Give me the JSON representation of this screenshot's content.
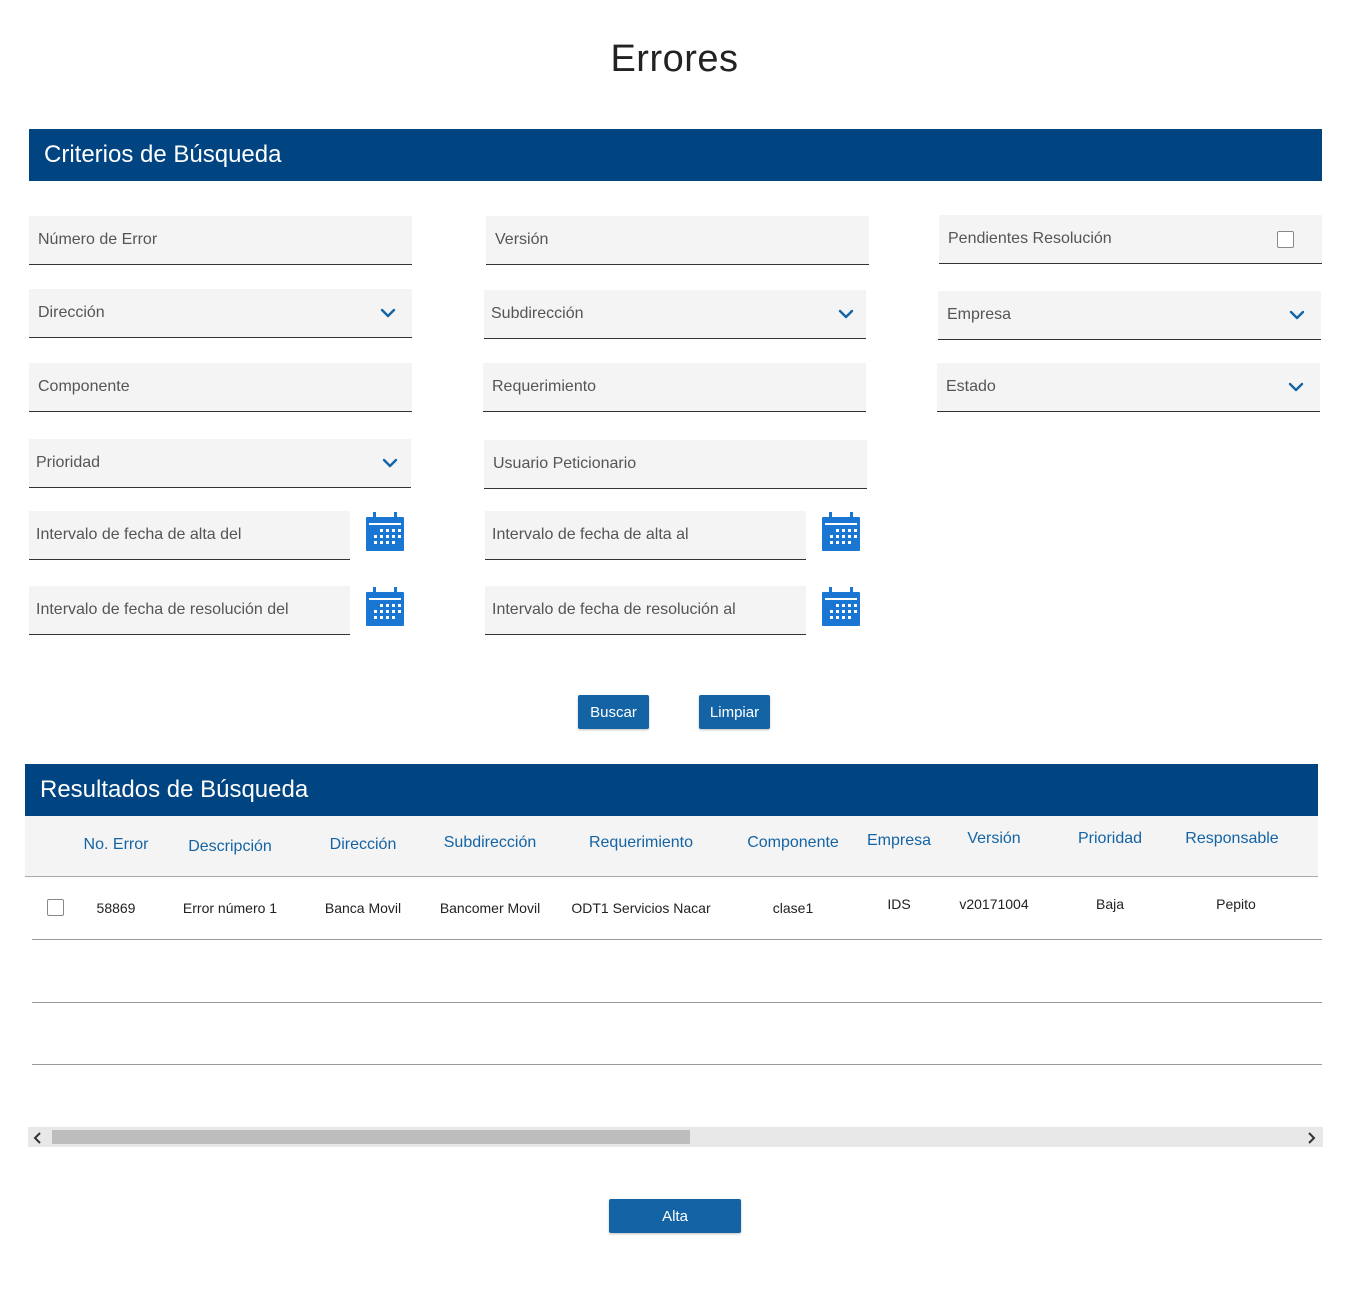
{
  "page": {
    "title": "Errores"
  },
  "search": {
    "section_title": "Criterios de Búsqueda",
    "fields": {
      "numero_error": "Número de Error",
      "version": "Versión",
      "pendientes": "Pendientes Resolución",
      "direccion": "Dirección",
      "subdireccion": "Subdirección",
      "empresa": "Empresa",
      "componente": "Componente",
      "requerimiento": "Requerimiento",
      "estado": "Estado",
      "prioridad": "Prioridad",
      "usuario": "Usuario Peticionario",
      "alta_del": "Intervalo de fecha de alta del",
      "alta_al": "Intervalo de fecha de alta al",
      "resolucion_del": "Intervalo de fecha de resolución del",
      "resolucion_al": "Intervalo de fecha de resolución al"
    },
    "buttons": {
      "buscar": "Buscar",
      "limpiar": "Limpiar"
    }
  },
  "results": {
    "section_title": "Resultados de Búsqueda",
    "columns": [
      "No. Error",
      "Descripción",
      "Dirección",
      "Subdirección",
      "Requerimiento",
      "Componente",
      "Empresa",
      "Versión",
      "Prioridad",
      "Responsable"
    ],
    "rows": [
      [
        "58869",
        "Error número 1",
        "Banca Movil",
        "Bancomer Movil",
        "ODT1 Servicios Nacar",
        "clase1",
        "IDS",
        "v20171004",
        "Baja",
        "Pepito"
      ]
    ],
    "scroll_fraction": 0.51
  },
  "footer": {
    "alta": "Alta"
  },
  "colors": {
    "brand": "#004481",
    "accent": "#1464a5",
    "field_bg": "#f4f4f4"
  },
  "icons": {
    "calendar": "calendar-icon",
    "dropdown": "chevron-down-icon",
    "scroll_left": "chevron-left-icon",
    "scroll_right": "chevron-right-icon"
  }
}
